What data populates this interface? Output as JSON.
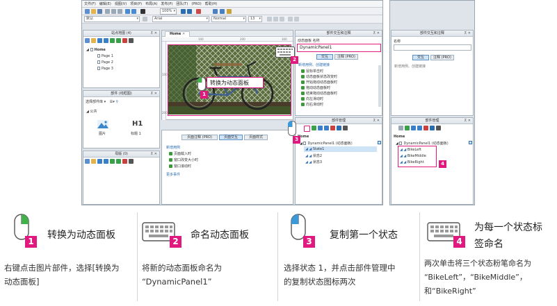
{
  "menu": [
    "文件(F)",
    "编辑(E)",
    "视图(V)",
    "项目(P)",
    "布局(A)",
    "发布(P)",
    "团队(T)",
    "(PRO)",
    "帮助(H)"
  ],
  "toolbar": {
    "zoom": "100%",
    "style": "默认",
    "font": "Arial",
    "weight": "Normal",
    "size": "13"
  },
  "sitemap": {
    "title": "站点地图 (4)",
    "root": "Home",
    "pages": [
      "Page 1",
      "Page 2",
      "Page 3"
    ]
  },
  "widgets": {
    "title": "部件 (线框图)",
    "selector": "选择部件库",
    "group": "公共",
    "items": [
      "图片",
      "标题 1"
    ],
    "heading_glyph": "H1"
  },
  "masters": {
    "title": "母版 (0)"
  },
  "canvas": {
    "tab": "Home",
    "ruler_ticks": [
      "100",
      "200",
      "300"
    ],
    "ruler_left": [
      "100",
      "200"
    ],
    "menu_item": "转换为动态面板"
  },
  "page_props": {
    "tabs": [
      "页面注释 (PRO)",
      "页面交互",
      "页面样式"
    ],
    "link": "新增用例",
    "events": [
      "页面载入时",
      "窗口改变大小时",
      "窗口滚动时"
    ],
    "more": "更多事件"
  },
  "interaction": {
    "title": "部件交互和注释",
    "field_label": "动态面板 名称",
    "name_value": "DynamicPanel1",
    "tabs": [
      "交互",
      "注释 (PRO)"
    ],
    "link": "新增用例、创建链接",
    "events": [
      "鼠标单击时",
      "动态面板状态改变时",
      "开始拖动动态面板时",
      "拖动动态面板时",
      "结束拖动动态面板时",
      "向左滑动时",
      "向右滑动时"
    ]
  },
  "outline": {
    "title": "部件管理",
    "root": "Home",
    "panel": "DynamicPanel1 (动态面板)",
    "states": [
      "State1",
      "状态2",
      "状态3"
    ]
  },
  "side": {
    "interaction_title": "部件交互和注释",
    "name_label": "名称",
    "tabs": [
      "交互",
      "注释 (PRO)"
    ],
    "link": "新增用例、创建链接",
    "outline_title": "部件管理",
    "root": "Home",
    "panel": "DynamicPanel1 (动态面板)",
    "states": [
      "BikeLeft",
      "BikeMiddle",
      "BikeRight"
    ]
  },
  "callouts": [
    "1",
    "2",
    "3",
    "4"
  ],
  "steps": [
    {
      "num": "1",
      "icon": "mouse-icon",
      "title": "转换为动态面板",
      "desc": [
        "右键点击图片部件，选择[转换为",
        "动态面板]"
      ]
    },
    {
      "num": "2",
      "icon": "keyboard-icon",
      "title": "命名动态面板",
      "desc": [
        "将新的动态面板命名为",
        "“DynamicPanel1”"
      ]
    },
    {
      "num": "3",
      "icon": "mouse-icon",
      "title": "复制第一个状态",
      "desc": [
        "选择状态 1，并点击部件管理中",
        "的复制状态图标两次"
      ]
    },
    {
      "num": "4",
      "icon": "keyboard-icon",
      "title": [
        "为每一个状态标",
        "签命名"
      ],
      "desc": [
        "两次单击将三个状态粉笔命名为",
        "“BikeLeft”，“BikeMiddle”，",
        "和“BikeRight”"
      ]
    }
  ],
  "colors": {
    "accent": "#e0197e",
    "mouse_button": "#3a9ad9",
    "mouse_green": "#41b24a"
  }
}
